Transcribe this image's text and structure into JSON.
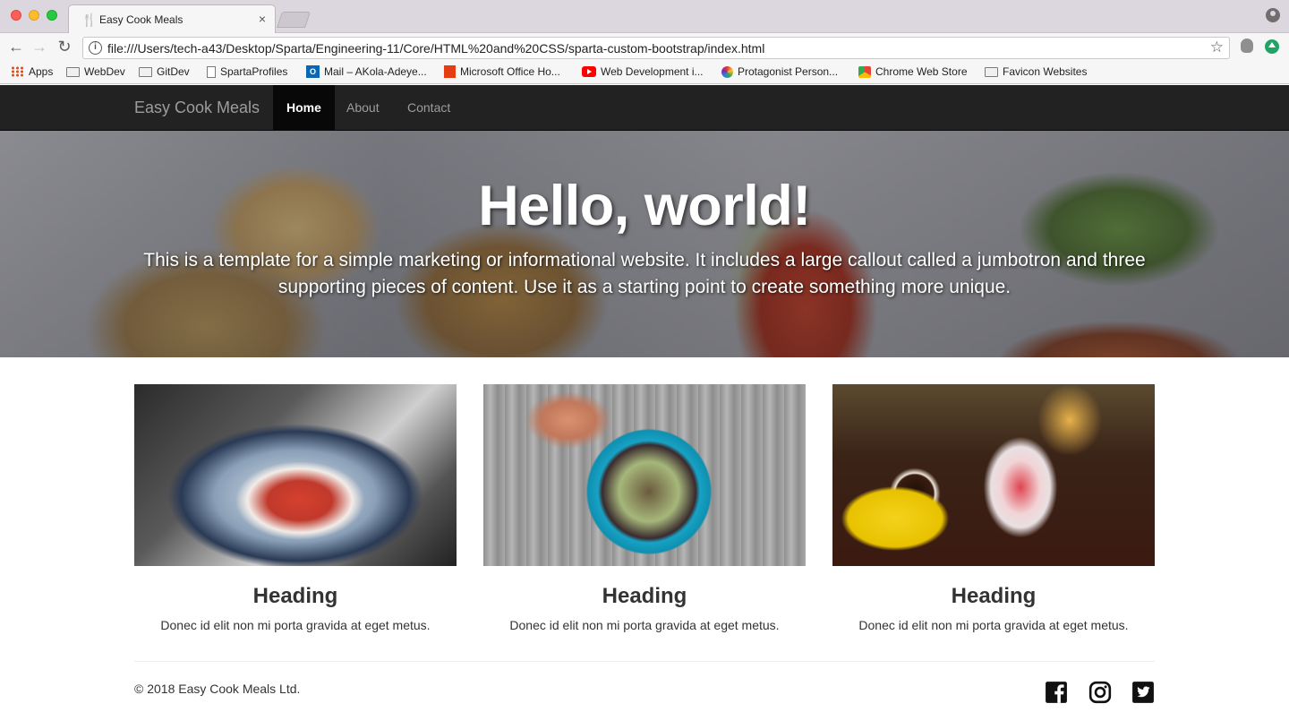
{
  "browser": {
    "tab_title": "Easy Cook Meals",
    "tab_close": "×",
    "url": "file:///Users/tech-a43/Desktop/Sparta/Engineering-11/Core/HTML%20and%20CSS/sparta-custom-bootstrap/index.html",
    "bookmarks": [
      {
        "label": "Apps",
        "icon": "apps-grid-icon"
      },
      {
        "label": "WebDev",
        "icon": "folder-icon"
      },
      {
        "label": "GitDev",
        "icon": "folder-icon"
      },
      {
        "label": "SpartaProfiles",
        "icon": "page-icon"
      },
      {
        "label": "Mail – AKola-Adeye...",
        "icon": "outlook-icon"
      },
      {
        "label": "Microsoft Office Ho...",
        "icon": "office-icon"
      },
      {
        "label": "Web Development i...",
        "icon": "youtube-icon"
      },
      {
        "label": "Protagonist Person...",
        "icon": "protagonist-icon"
      },
      {
        "label": "Chrome Web Store",
        "icon": "chrome-web-store-icon"
      },
      {
        "label": "Favicon Websites",
        "icon": "folder-icon"
      }
    ]
  },
  "site": {
    "brand": "Easy Cook Meals",
    "nav": [
      {
        "label": "Home",
        "active": true
      },
      {
        "label": "About",
        "active": false
      },
      {
        "label": "Contact",
        "active": false
      }
    ],
    "jumbotron": {
      "title": "Hello, world!",
      "text": "This is a template for a simple marketing or informational website. It includes a large callout called a jumbotron and three supporting pieces of content. Use it as a starting point to create something more unique."
    },
    "cards": [
      {
        "heading": "Heading",
        "text": "Donec id elit non mi porta gravida at eget metus."
      },
      {
        "heading": "Heading",
        "text": "Donec id elit non mi porta gravida at eget metus."
      },
      {
        "heading": "Heading",
        "text": "Donec id elit non mi porta gravida at eget metus."
      }
    ],
    "footer": {
      "copyright": "© 2018 Easy Cook Meals Ltd.",
      "social": [
        "facebook-icon",
        "instagram-icon",
        "twitter-icon"
      ]
    }
  },
  "colors": {
    "navbar_bg": "#222222",
    "navbar_active_bg": "#080808",
    "navbar_text": "#9d9d9d"
  }
}
